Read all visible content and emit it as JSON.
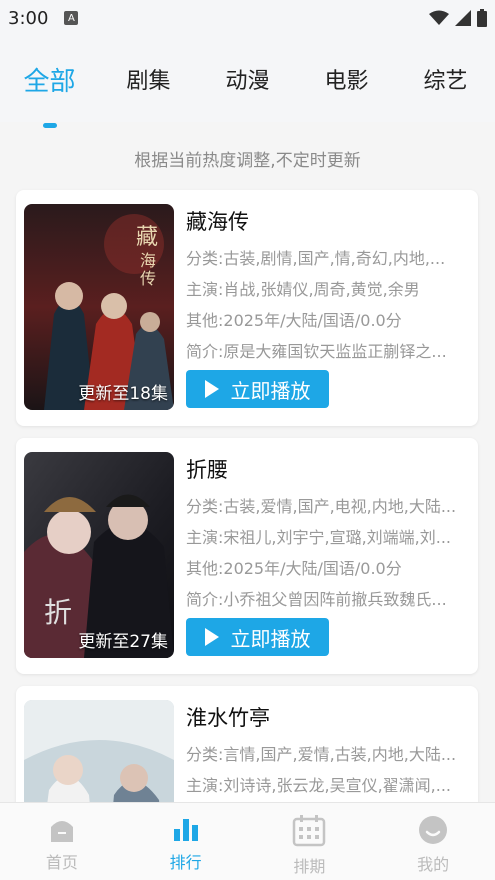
{
  "status": {
    "time": "3:00",
    "app_icon": "A"
  },
  "tabs": [
    {
      "label": "全部",
      "active": true
    },
    {
      "label": "剧集",
      "active": false
    },
    {
      "label": "动漫",
      "active": false
    },
    {
      "label": "电影",
      "active": false
    },
    {
      "label": "综艺",
      "active": false
    }
  ],
  "hint": "根据当前热度调整,不定时更新",
  "cards": [
    {
      "title": "藏海传",
      "category": "分类:古装,剧情,国产,情,奇幻,内地,...",
      "cast": "主演:肖战,张婧仪,周奇,黄觉,余男",
      "other": "其他:2025年/大陆/国语/0.0分",
      "intro": "简介:原是大雍国钦天监监正蒯铎之...",
      "badge": "更新至18集",
      "play_label": "立即播放"
    },
    {
      "title": "折腰",
      "category": "分类:古装,爱情,国产,电视,内地,大陆...",
      "cast": "主演:宋祖儿,刘宇宁,宣璐,刘端端,刘...",
      "other": "其他:2025年/大陆/国语/0.0分",
      "intro": "简介:小乔祖父曾因阵前撤兵致魏氏...",
      "badge": "更新至27集",
      "play_label": "立即播放"
    },
    {
      "title": "淮水竹亭",
      "category": "分类:言情,国产,爱情,古装,内地,大陆...",
      "cast": "主演:刘诗诗,张云龙,吴宣仪,翟潇闻,..."
    }
  ],
  "nav": [
    {
      "label": "首页",
      "icon": "home-icon"
    },
    {
      "label": "排行",
      "icon": "ranking-icon",
      "active": true
    },
    {
      "label": "排期",
      "icon": "calendar-icon"
    },
    {
      "label": "我的",
      "icon": "profile-icon"
    }
  ],
  "colors": {
    "accent": "#1ea7e6",
    "meta_text": "#999999"
  }
}
